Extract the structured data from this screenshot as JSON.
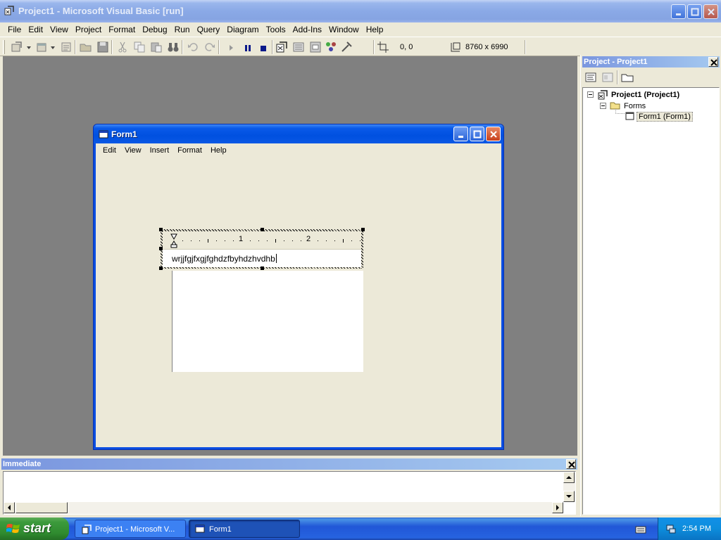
{
  "app": {
    "title": "Project1 - Microsoft Visual Basic [run]"
  },
  "menu": {
    "items": [
      "File",
      "Edit",
      "View",
      "Project",
      "Format",
      "Debug",
      "Run",
      "Query",
      "Diagram",
      "Tools",
      "Add-Ins",
      "Window",
      "Help"
    ]
  },
  "toolbar": {
    "position": "0, 0",
    "size": "8760 x 6990"
  },
  "form1": {
    "title": "Form1",
    "menu": [
      "Edit",
      "View",
      "Insert",
      "Format",
      "Help"
    ],
    "ruler_labels": [
      "1",
      "2"
    ],
    "text": "wrjjfgjfxgjfghdzfbyhdzhvdhb"
  },
  "project": {
    "title": "Project - Project1",
    "root": "Project1 (Project1)",
    "folder": "Forms",
    "form": "Form1 (Form1)"
  },
  "immediate": {
    "title": "Immediate"
  },
  "taskbar": {
    "start": "start",
    "tasks": [
      "Project1 - Microsoft V...",
      "Form1"
    ],
    "clock": "2:54 PM"
  },
  "colors": {
    "xp_blue": "#0a4de0",
    "mdi_gray": "#808080",
    "start_green": "#3c9a3c",
    "face": "#ece9d8"
  }
}
